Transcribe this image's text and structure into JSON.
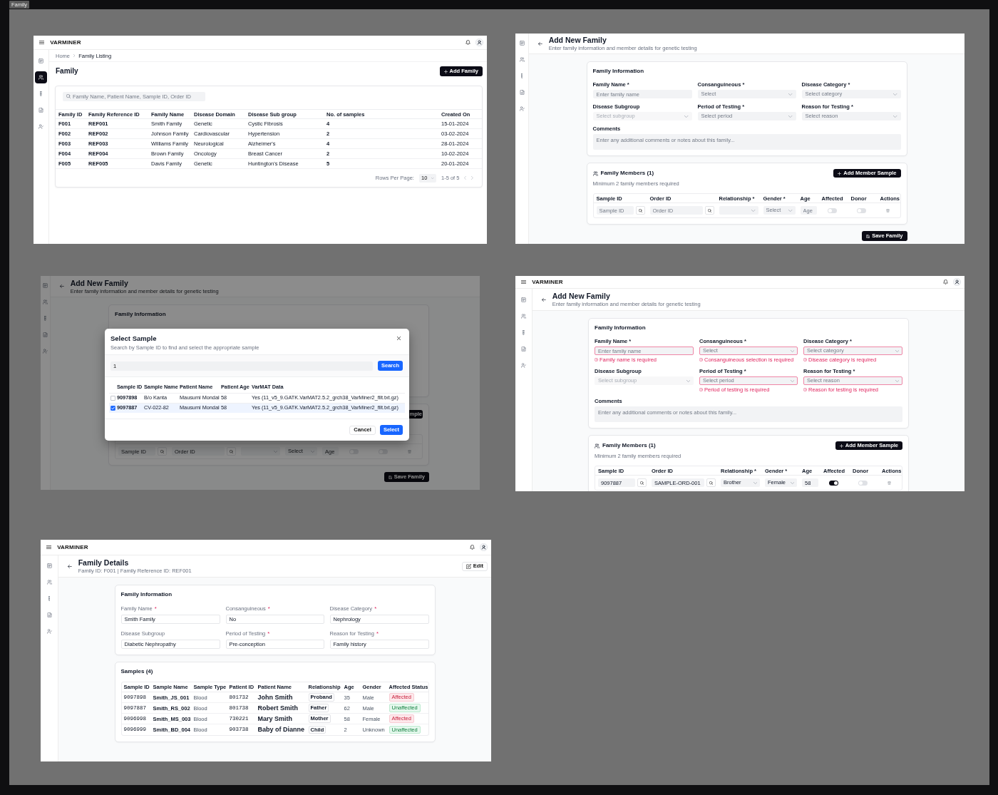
{
  "canvas": {
    "tab": "Family"
  },
  "frames": [
    {
      "kind": "listing",
      "app_bar": {
        "brand": "VARMINER"
      },
      "sidebar": [
        {
          "selected": false
        },
        {
          "selected": true
        },
        {
          "selected": false
        },
        {
          "selected": false
        },
        {
          "selected": false
        }
      ],
      "breadcrumb": [
        {
          "label": "Home",
          "current": false
        },
        {
          "label": "Family Listing",
          "current": true
        }
      ],
      "title": "Family",
      "action": "Add Family",
      "search": {
        "placeholder": "Family Name, Patient Name, Sample ID, Order ID"
      },
      "table": {
        "columns": [
          "Family ID",
          "Family Reference ID",
          "Family Name",
          "Disease Domain",
          "Disease Sub group",
          "No. of samples",
          "Created On"
        ],
        "rows": [
          [
            "F001",
            "REF001",
            "Smith Family",
            "Genetic",
            "Cystic Fibrosis",
            "4",
            "15-01-2024"
          ],
          [
            "F002",
            "REF002",
            "Johnson Family",
            "Cardiovascular",
            "Hypertension",
            "2",
            "03-02-2024"
          ],
          [
            "F003",
            "REF003",
            "Williams Family",
            "Neurological",
            "Alzheimer's",
            "4",
            "28-01-2024"
          ],
          [
            "F004",
            "REF004",
            "Brown Family",
            "Oncology",
            "Breast Cancer",
            "2",
            "10-02-2024"
          ],
          [
            "F005",
            "REF005",
            "Davis Family",
            "Genetic",
            "Huntington's Disease",
            "5",
            "20-01-2024"
          ]
        ]
      },
      "pagination": {
        "label": "Rows Per Page:",
        "page_size": "10",
        "range": "1-5 of 5"
      }
    },
    {
      "kind": "form",
      "sidebar": [
        {
          "selected": false
        },
        {
          "selected": false
        },
        {
          "selected": false
        },
        {
          "selected": false
        },
        {
          "selected": false
        }
      ],
      "header": {
        "title": "Add New Family",
        "subtitle": "Enter family information and member details for genetic testing"
      },
      "info": {
        "title": "Family Information",
        "fields": [
          {
            "kind": "text",
            "label": "Family Name *",
            "placeholder": "Enter family name",
            "disabled": false
          },
          {
            "kind": "select",
            "label": "Consanguineous *",
            "placeholder": "Select",
            "disabled": false
          },
          {
            "kind": "select",
            "label": "Disease Category *",
            "placeholder": "Select category",
            "disabled": false
          },
          {
            "kind": "select",
            "label": "Disease Subgroup",
            "placeholder": "Select subgroup",
            "disabled": true
          },
          {
            "kind": "select",
            "label": "Period of Testing *",
            "placeholder": "Select period",
            "disabled": false
          },
          {
            "kind": "select",
            "label": "Reason for Testing *",
            "placeholder": "Select reason",
            "disabled": false
          },
          {
            "kind": "textarea",
            "label": "Comments",
            "placeholder": "Enter any additional comments or notes about this family...",
            "disabled": false
          }
        ]
      },
      "members": {
        "title": "Family Members (1)",
        "hint": "Minimum 2 family members required",
        "action": "Add Member Sample",
        "columns": [
          "Sample ID",
          "Order ID",
          "Relationship *",
          "Gender *",
          "Age",
          "Affected",
          "Donor",
          "Actions"
        ],
        "rows": [
          {
            "cells": [
              {
                "kind": "lookup",
                "placeholder": "Sample ID"
              },
              {
                "kind": "lookup",
                "placeholder": "Order ID"
              },
              {
                "kind": "select"
              },
              {
                "kind": "select",
                "placeholder": "Select"
              },
              {
                "kind": "input",
                "placeholder": "Age"
              },
              {
                "kind": "switch",
                "on": false
              },
              {
                "kind": "switch",
                "on": false
              },
              {
                "kind": "delete"
              }
            ]
          }
        ]
      },
      "save": "Save Family"
    },
    {
      "kind": "form",
      "sidebar": [
        {
          "selected": false
        },
        {
          "selected": false
        },
        {
          "selected": false
        },
        {
          "selected": false
        },
        {
          "selected": false
        }
      ],
      "header": {
        "title": "Add New Family",
        "subtitle": "Enter family information and member details for genetic testing"
      },
      "info": {
        "title": "Family Information"
      },
      "members": {
        "action_cut": "mple",
        "rows": [
          {
            "cells": [
              {
                "kind": "lookup",
                "placeholder": "Sample ID"
              },
              {
                "kind": "lookup",
                "placeholder": "Order ID"
              },
              {
                "kind": "select"
              },
              {
                "kind": "select",
                "placeholder": "Select"
              },
              {
                "kind": "input",
                "placeholder": "Age"
              },
              {
                "kind": "switch",
                "on": false
              },
              {
                "kind": "switch",
                "on": false
              },
              {
                "kind": "delete"
              }
            ]
          }
        ]
      },
      "save": "Save Family",
      "dialog": {
        "title": "Select Sample",
        "subtitle": "Search by Sample ID to find and select the appropriate sample",
        "search": {
          "value": "1"
        },
        "search_button": "Search",
        "columns": [
          "Sample ID",
          "Sample Name",
          "Patient Name",
          "Patient Age",
          "VarMAT Data"
        ],
        "rows": [
          {
            "selected": false,
            "cells": [
              "9097898",
              "B/o Kanta",
              "Mausumi Mondal",
              "58",
              "Yes (11_v5_9.GATK.VarMAT2.5.2_grch38_VarMiner2_filt.txt.gz)"
            ]
          },
          {
            "selected": true,
            "cells": [
              "9097887",
              "CV-022-82",
              "Mausumi Mondal",
              "58",
              "Yes (11_v5_9.GATK.VarMAT2.5.2_grch38_VarMiner2_filt.txt.gz)"
            ]
          }
        ],
        "buttons": [
          {
            "kind": "secondary",
            "label": "Cancel"
          },
          {
            "kind": "primary",
            "label": "Select"
          }
        ]
      }
    },
    {
      "kind": "form",
      "app_bar": {
        "brand": "VARMINER"
      },
      "sidebar": [
        {
          "selected": false
        },
        {
          "selected": false
        },
        {
          "selected": false
        },
        {
          "selected": false
        },
        {
          "selected": false
        }
      ],
      "header": {
        "title": "Add New Family",
        "subtitle": "Enter family information and member details for genetic testing"
      },
      "info": {
        "title": "Family Information",
        "fields": [
          {
            "kind": "text",
            "label": "Family Name *",
            "placeholder": "Enter family name",
            "disabled": false,
            "error": "Family name is required"
          },
          {
            "kind": "select",
            "label": "Consanguineous *",
            "placeholder": "Select",
            "disabled": false,
            "error": "Consanguineous selection is required"
          },
          {
            "kind": "select",
            "label": "Disease Category *",
            "placeholder": "Select category",
            "disabled": false,
            "error": "Disease category is required"
          },
          {
            "kind": "select",
            "label": "Disease Subgroup",
            "placeholder": "Select subgroup",
            "disabled": true
          },
          {
            "kind": "select",
            "label": "Period of Testing *",
            "placeholder": "Select period",
            "disabled": false,
            "error": "Period of testing is required"
          },
          {
            "kind": "select",
            "label": "Reason for Testing *",
            "placeholder": "Select reason",
            "disabled": false,
            "error": "Reason for testing is required"
          },
          {
            "kind": "textarea",
            "label": "Comments",
            "placeholder": "Enter any additional comments or notes about this family...",
            "disabled": false
          }
        ]
      },
      "members": {
        "title": "Family Members (1)",
        "hint": "Minimum 2 family members required",
        "action": "Add Member Sample",
        "columns": [
          "Sample ID",
          "Order ID",
          "Relationship *",
          "Gender *",
          "Age",
          "Affected",
          "Donor",
          "Actions"
        ],
        "rows": [
          {
            "cells": [
              {
                "kind": "lookup",
                "value": "9097887"
              },
              {
                "kind": "lookup",
                "value": "SAMPLE-ORD-001"
              },
              {
                "kind": "select",
                "value": "Brother"
              },
              {
                "kind": "select",
                "value": "Female"
              },
              {
                "kind": "input",
                "value": "58"
              },
              {
                "kind": "switch",
                "on": true
              },
              {
                "kind": "switch",
                "on": false
              },
              {
                "kind": "delete"
              }
            ]
          }
        ]
      }
    },
    {
      "kind": "details",
      "app_bar": {
        "brand": "VARMINER"
      },
      "sidebar": [
        {
          "selected": false
        },
        {
          "selected": false
        },
        {
          "selected": false
        },
        {
          "selected": false
        },
        {
          "selected": false
        }
      ],
      "header": {
        "title": "Family Details",
        "subtitle": "Family ID: F001 | Family Reference ID: REF001",
        "action": "Edit"
      },
      "info": {
        "title": "Family Information",
        "fields": [
          {
            "label": "Family Name",
            "required": "*",
            "value": "Smith Family"
          },
          {
            "label": "Consanguineous",
            "required": "*",
            "value": "No"
          },
          {
            "label": "Disease Category",
            "required": "*",
            "value": "Nephrology"
          },
          {
            "label": "Disease Subgroup",
            "value": "Diabetic Nephropathy"
          },
          {
            "label": "Period of Testing",
            "required": "*",
            "value": "Pre-conception"
          },
          {
            "label": "Reason for Testing",
            "required": "*",
            "value": "Family history"
          }
        ]
      },
      "samples": {
        "title": "Samples (4)",
        "columns": [
          "Sample ID",
          "Sample Name",
          "Sample Type",
          "Patient ID",
          "Patient Name",
          "Relationship",
          "Age",
          "Gender",
          "Affected Status"
        ],
        "rows": [
          {
            "sample_id": "9097898",
            "sample_name": "Smith_JS_001",
            "sample_type": "Blood",
            "patient_id": "801732",
            "patient_name": "John Smith",
            "relationship": "Proband",
            "age": "35",
            "gender": "Male",
            "status": "Affected",
            "affected": true
          },
          {
            "sample_id": "9097887",
            "sample_name": "Smith_RS_002",
            "sample_type": "Blood",
            "patient_id": "801738",
            "patient_name": "Robert Smith",
            "relationship": "Father",
            "age": "62",
            "gender": "Male",
            "status": "Unaffected",
            "affected": false
          },
          {
            "sample_id": "9096998",
            "sample_name": "Smith_MS_003",
            "sample_type": "Blood",
            "patient_id": "730221",
            "patient_name": "Mary Smith",
            "relationship": "Mother",
            "age": "58",
            "gender": "Female",
            "status": "Affected",
            "affected": true
          },
          {
            "sample_id": "9096999",
            "sample_name": "Smith_BD_004",
            "sample_type": "Blood",
            "patient_id": "903738",
            "patient_name": "Baby of Dianne",
            "relationship": "Child",
            "age": "2",
            "gender": "Unknown",
            "status": "Unaffected",
            "affected": false
          }
        ]
      }
    }
  ]
}
